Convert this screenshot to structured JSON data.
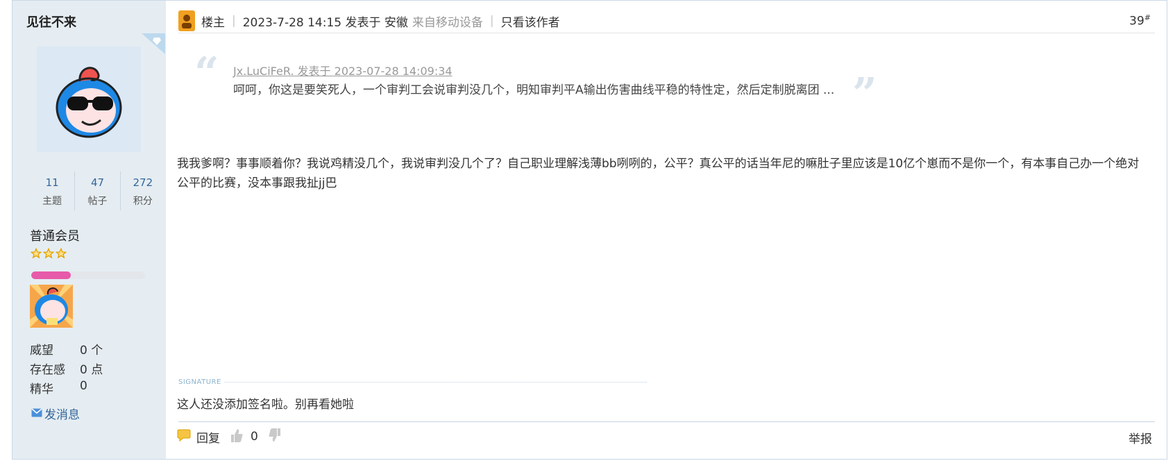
{
  "author": {
    "name": "见往不来",
    "stats": [
      {
        "value": "11",
        "label": "主题"
      },
      {
        "value": "47",
        "label": "帖子"
      },
      {
        "value": "272",
        "label": "积分"
      }
    ],
    "rank": "普通会员",
    "star_count": 3,
    "level_progress": 0.35,
    "info": [
      {
        "key": "威望",
        "value": "0 个"
      },
      {
        "key": "存在感",
        "value": "0 点"
      },
      {
        "key": "精华",
        "value": "0"
      }
    ],
    "send_message": "发消息"
  },
  "post": {
    "role": "楼主",
    "time": "2023-7-28 14:15 发表于 安徽",
    "device": "来自移动设备",
    "only_author": "只看该作者",
    "floor_number": "39",
    "floor_suffix": "#",
    "quote": {
      "author_line": "Jx.LuCiFeR. 发表于 2023-07-28 14:09:34",
      "text": "呵呵，你这是要笑死人，一个审判工会说审判没几个，明知审判平A输出伤害曲线平稳的特性定，然后定制脱离团 ..."
    },
    "body": "我我爹啊？事事顺着你？我说鸡精没几个，我说审判没几个了？自己职业理解浅薄bb咧咧的，公平？真公平的话当年尼的嘛肚子里应该是10亿个崽而不是你一个，有本事自己办一个绝对公平的比赛，没本事跟我扯jj巴",
    "signature_label": "SIGNATURE",
    "signature": "这人还没添加签名啦。别再看她啦",
    "actions": {
      "reply": "回复",
      "like_count": "0",
      "report": "举报"
    }
  },
  "colors": {
    "sidebar_bg": "#e5edf2",
    "link": "#336699",
    "progress": "#e75aa9",
    "avatar_blue": "#1e88e5"
  }
}
